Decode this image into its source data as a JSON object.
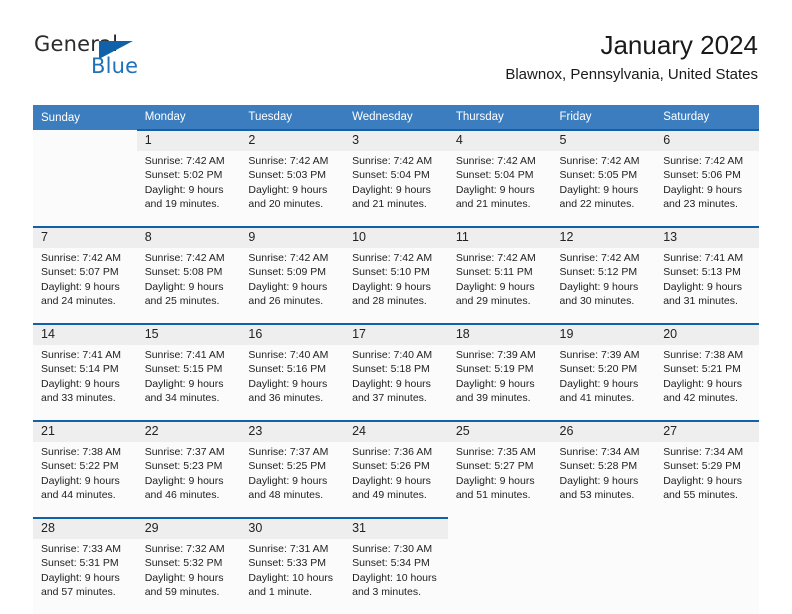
{
  "brand": {
    "word1": "General",
    "word2": "Blue",
    "flag_icon": "triangle-flag-icon",
    "accent_color": "#1161a8"
  },
  "header": {
    "title": "January 2024",
    "subtitle": "Blawnox, Pennsylvania, United States"
  },
  "calendar": {
    "header_bg": "#3b7dbf",
    "daynum_bg": "#eeeeee",
    "weekday_headers": [
      "Sunday",
      "Monday",
      "Tuesday",
      "Wednesday",
      "Thursday",
      "Friday",
      "Saturday"
    ],
    "weeks": [
      [
        {
          "day": "",
          "lines": []
        },
        {
          "day": "1",
          "lines": [
            "Sunrise: 7:42 AM",
            "Sunset: 5:02 PM",
            "Daylight: 9 hours",
            "and 19 minutes."
          ]
        },
        {
          "day": "2",
          "lines": [
            "Sunrise: 7:42 AM",
            "Sunset: 5:03 PM",
            "Daylight: 9 hours",
            "and 20 minutes."
          ]
        },
        {
          "day": "3",
          "lines": [
            "Sunrise: 7:42 AM",
            "Sunset: 5:04 PM",
            "Daylight: 9 hours",
            "and 21 minutes."
          ]
        },
        {
          "day": "4",
          "lines": [
            "Sunrise: 7:42 AM",
            "Sunset: 5:04 PM",
            "Daylight: 9 hours",
            "and 21 minutes."
          ]
        },
        {
          "day": "5",
          "lines": [
            "Sunrise: 7:42 AM",
            "Sunset: 5:05 PM",
            "Daylight: 9 hours",
            "and 22 minutes."
          ]
        },
        {
          "day": "6",
          "lines": [
            "Sunrise: 7:42 AM",
            "Sunset: 5:06 PM",
            "Daylight: 9 hours",
            "and 23 minutes."
          ]
        }
      ],
      [
        {
          "day": "7",
          "lines": [
            "Sunrise: 7:42 AM",
            "Sunset: 5:07 PM",
            "Daylight: 9 hours",
            "and 24 minutes."
          ]
        },
        {
          "day": "8",
          "lines": [
            "Sunrise: 7:42 AM",
            "Sunset: 5:08 PM",
            "Daylight: 9 hours",
            "and 25 minutes."
          ]
        },
        {
          "day": "9",
          "lines": [
            "Sunrise: 7:42 AM",
            "Sunset: 5:09 PM",
            "Daylight: 9 hours",
            "and 26 minutes."
          ]
        },
        {
          "day": "10",
          "lines": [
            "Sunrise: 7:42 AM",
            "Sunset: 5:10 PM",
            "Daylight: 9 hours",
            "and 28 minutes."
          ]
        },
        {
          "day": "11",
          "lines": [
            "Sunrise: 7:42 AM",
            "Sunset: 5:11 PM",
            "Daylight: 9 hours",
            "and 29 minutes."
          ]
        },
        {
          "day": "12",
          "lines": [
            "Sunrise: 7:42 AM",
            "Sunset: 5:12 PM",
            "Daylight: 9 hours",
            "and 30 minutes."
          ]
        },
        {
          "day": "13",
          "lines": [
            "Sunrise: 7:41 AM",
            "Sunset: 5:13 PM",
            "Daylight: 9 hours",
            "and 31 minutes."
          ]
        }
      ],
      [
        {
          "day": "14",
          "lines": [
            "Sunrise: 7:41 AM",
            "Sunset: 5:14 PM",
            "Daylight: 9 hours",
            "and 33 minutes."
          ]
        },
        {
          "day": "15",
          "lines": [
            "Sunrise: 7:41 AM",
            "Sunset: 5:15 PM",
            "Daylight: 9 hours",
            "and 34 minutes."
          ]
        },
        {
          "day": "16",
          "lines": [
            "Sunrise: 7:40 AM",
            "Sunset: 5:16 PM",
            "Daylight: 9 hours",
            "and 36 minutes."
          ]
        },
        {
          "day": "17",
          "lines": [
            "Sunrise: 7:40 AM",
            "Sunset: 5:18 PM",
            "Daylight: 9 hours",
            "and 37 minutes."
          ]
        },
        {
          "day": "18",
          "lines": [
            "Sunrise: 7:39 AM",
            "Sunset: 5:19 PM",
            "Daylight: 9 hours",
            "and 39 minutes."
          ]
        },
        {
          "day": "19",
          "lines": [
            "Sunrise: 7:39 AM",
            "Sunset: 5:20 PM",
            "Daylight: 9 hours",
            "and 41 minutes."
          ]
        },
        {
          "day": "20",
          "lines": [
            "Sunrise: 7:38 AM",
            "Sunset: 5:21 PM",
            "Daylight: 9 hours",
            "and 42 minutes."
          ]
        }
      ],
      [
        {
          "day": "21",
          "lines": [
            "Sunrise: 7:38 AM",
            "Sunset: 5:22 PM",
            "Daylight: 9 hours",
            "and 44 minutes."
          ]
        },
        {
          "day": "22",
          "lines": [
            "Sunrise: 7:37 AM",
            "Sunset: 5:23 PM",
            "Daylight: 9 hours",
            "and 46 minutes."
          ]
        },
        {
          "day": "23",
          "lines": [
            "Sunrise: 7:37 AM",
            "Sunset: 5:25 PM",
            "Daylight: 9 hours",
            "and 48 minutes."
          ]
        },
        {
          "day": "24",
          "lines": [
            "Sunrise: 7:36 AM",
            "Sunset: 5:26 PM",
            "Daylight: 9 hours",
            "and 49 minutes."
          ]
        },
        {
          "day": "25",
          "lines": [
            "Sunrise: 7:35 AM",
            "Sunset: 5:27 PM",
            "Daylight: 9 hours",
            "and 51 minutes."
          ]
        },
        {
          "day": "26",
          "lines": [
            "Sunrise: 7:34 AM",
            "Sunset: 5:28 PM",
            "Daylight: 9 hours",
            "and 53 minutes."
          ]
        },
        {
          "day": "27",
          "lines": [
            "Sunrise: 7:34 AM",
            "Sunset: 5:29 PM",
            "Daylight: 9 hours",
            "and 55 minutes."
          ]
        }
      ],
      [
        {
          "day": "28",
          "lines": [
            "Sunrise: 7:33 AM",
            "Sunset: 5:31 PM",
            "Daylight: 9 hours",
            "and 57 minutes."
          ]
        },
        {
          "day": "29",
          "lines": [
            "Sunrise: 7:32 AM",
            "Sunset: 5:32 PM",
            "Daylight: 9 hours",
            "and 59 minutes."
          ]
        },
        {
          "day": "30",
          "lines": [
            "Sunrise: 7:31 AM",
            "Sunset: 5:33 PM",
            "Daylight: 10 hours",
            "and 1 minute."
          ]
        },
        {
          "day": "31",
          "lines": [
            "Sunrise: 7:30 AM",
            "Sunset: 5:34 PM",
            "Daylight: 10 hours",
            "and 3 minutes."
          ]
        },
        {
          "day": "",
          "lines": []
        },
        {
          "day": "",
          "lines": []
        },
        {
          "day": "",
          "lines": []
        }
      ]
    ]
  }
}
